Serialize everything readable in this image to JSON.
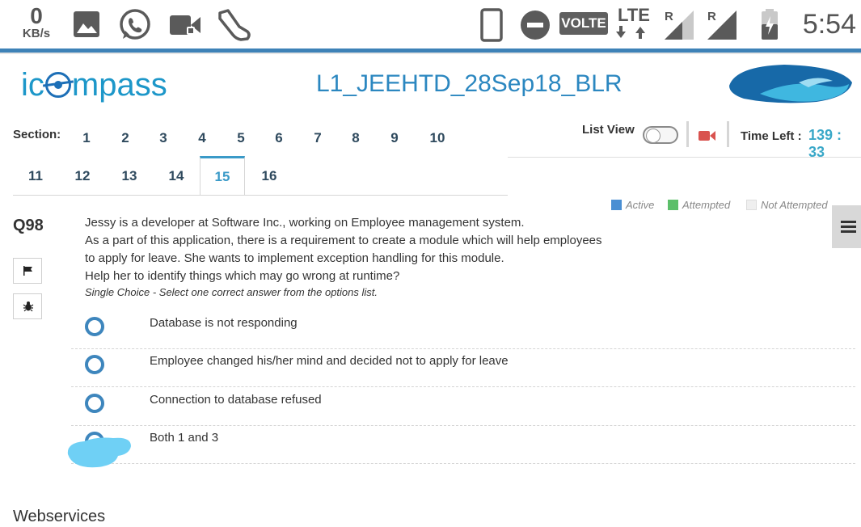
{
  "status_bar": {
    "net_speed_value": "0",
    "net_speed_unit": "KB/s",
    "volte": "VOLTE",
    "lte": "LTE",
    "roaming_1": "R",
    "roaming_2": "R",
    "time": "5:54",
    "icons": [
      "gallery-icon",
      "whatsapp-icon",
      "video-call-icon",
      "shoe-icon",
      "phone-icon",
      "do-not-disturb-icon",
      "signal-icon",
      "signal-icon",
      "battery-icon"
    ]
  },
  "header": {
    "logo_text_prefix": "ic",
    "logo_text_suffix": "mpass",
    "exam_title": "L1_JEEHTD_28Sep18_BLR"
  },
  "sections": {
    "label": "Section:",
    "items": [
      "1",
      "2",
      "3",
      "4",
      "5",
      "6",
      "7",
      "8",
      "9",
      "10",
      "11",
      "12",
      "13",
      "14",
      "15",
      "16"
    ],
    "active": "15"
  },
  "controls": {
    "list_view_label": "List View",
    "time_left_label": "Time Left :",
    "time_left_value": "139 : 33"
  },
  "legend": {
    "active": "Active",
    "attempted": "Attempted",
    "not_attempted": "Not Attempted",
    "colors": {
      "active": "#4a8fd3",
      "attempted": "#5cbf6a",
      "not_attempted": "#efefef"
    }
  },
  "question": {
    "number": "Q98",
    "lines": [
      "Jessy is a developer at Software Inc., working on Employee management system.",
      "As a part of this application, there is a requirement to create a module which will help employees",
      "to apply for leave. She wants to implement exception handling for this module.",
      "Help her to identify things which may go wrong at runtime?"
    ],
    "hint": "Single Choice - Select one correct answer from the options list.",
    "options": [
      "Database is not responding",
      "Employee changed his/her mind and decided not to apply for leave",
      "Connection to database refused",
      "Both 1 and 3"
    ]
  },
  "next_section_title": "Webservices"
}
